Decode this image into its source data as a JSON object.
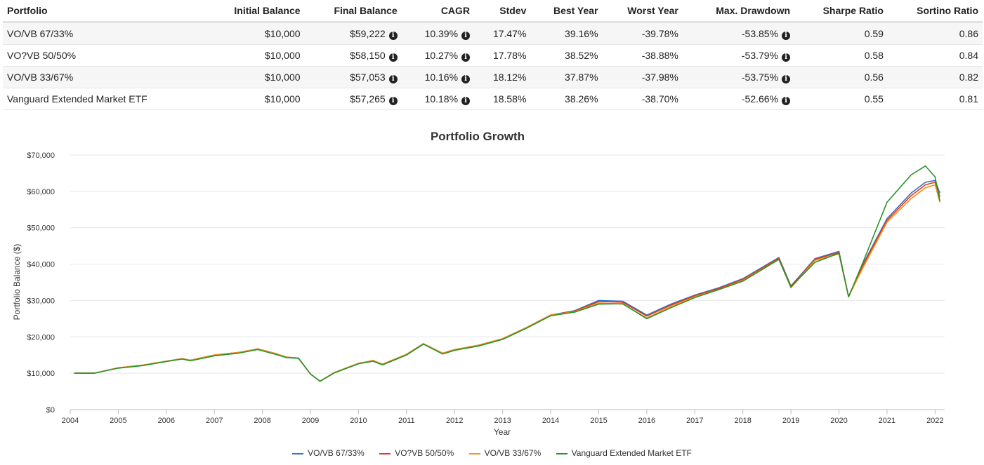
{
  "table": {
    "headers": [
      "Portfolio",
      "Initial Balance",
      "Final Balance",
      "CAGR",
      "Stdev",
      "Best Year",
      "Worst Year",
      "Max. Drawdown",
      "Sharpe Ratio",
      "Sortino Ratio"
    ],
    "rows": [
      {
        "portfolio": "VO/VB 67/33%",
        "initial": "$10,000",
        "final": "$59,222",
        "cagr": "10.39%",
        "stdev": "17.47%",
        "best": "39.16%",
        "worst": "-39.78%",
        "maxdd": "-53.85%",
        "sharpe": "0.59",
        "sortino": "0.86"
      },
      {
        "portfolio": "VO?VB 50/50%",
        "initial": "$10,000",
        "final": "$58,150",
        "cagr": "10.27%",
        "stdev": "17.78%",
        "best": "38.52%",
        "worst": "-38.88%",
        "maxdd": "-53.79%",
        "sharpe": "0.58",
        "sortino": "0.84"
      },
      {
        "portfolio": "VO/VB 33/67%",
        "initial": "$10,000",
        "final": "$57,053",
        "cagr": "10.16%",
        "stdev": "18.12%",
        "best": "37.87%",
        "worst": "-37.98%",
        "maxdd": "-53.75%",
        "sharpe": "0.56",
        "sortino": "0.82"
      },
      {
        "portfolio": "Vanguard Extended Market ETF",
        "initial": "$10,000",
        "final": "$57,265",
        "cagr": "10.18%",
        "stdev": "18.58%",
        "best": "38.26%",
        "worst": "-38.70%",
        "maxdd": "-52.66%",
        "sharpe": "0.55",
        "sortino": "0.81"
      }
    ]
  },
  "chart_data": {
    "type": "line",
    "title": "Portfolio Growth",
    "xlabel": "Year",
    "ylabel": "Portfolio Balance ($)",
    "xlim": [
      2004.0,
      2022.2
    ],
    "ylim": [
      0,
      70000
    ],
    "x_ticks": [
      "2004",
      "2005",
      "2006",
      "2007",
      "2008",
      "2009",
      "2010",
      "2011",
      "2012",
      "2013",
      "2014",
      "2015",
      "2016",
      "2017",
      "2018",
      "2019",
      "2020",
      "2021",
      "2022"
    ],
    "y_ticks": [
      "$0",
      "$10,000",
      "$20,000",
      "$30,000",
      "$40,000",
      "$50,000",
      "$60,000",
      "$70,000"
    ],
    "grid": true,
    "legend_position": "bottom",
    "x": [
      2004.08,
      2004.5,
      2005.0,
      2005.5,
      2006.0,
      2006.33,
      2006.5,
      2007.0,
      2007.5,
      2007.9,
      2008.25,
      2008.5,
      2008.75,
      2009.0,
      2009.2,
      2009.5,
      2010.0,
      2010.3,
      2010.5,
      2011.0,
      2011.35,
      2011.75,
      2012.0,
      2012.5,
      2013.0,
      2013.5,
      2014.0,
      2014.5,
      2015.0,
      2015.5,
      2016.0,
      2016.5,
      2017.0,
      2017.5,
      2018.0,
      2018.75,
      2019.0,
      2019.5,
      2020.0,
      2020.2,
      2020.5,
      2021.0,
      2021.5,
      2021.8,
      2022.0,
      2022.1
    ],
    "series": [
      {
        "name": "VO/VB 67/33%",
        "color": "#3a6fc4",
        "values": [
          10000,
          10000,
          11500,
          12200,
          13300,
          14000,
          13600,
          15000,
          15700,
          16700,
          15500,
          14400,
          14200,
          9800,
          7800,
          10200,
          12700,
          13500,
          12500,
          15200,
          18100,
          15500,
          16500,
          17700,
          19500,
          22600,
          26000,
          27200,
          30000,
          29800,
          26000,
          29000,
          31500,
          33500,
          36000,
          41800,
          34000,
          41500,
          43500,
          31000,
          40000,
          52500,
          59500,
          62500,
          63000,
          59500
        ]
      },
      {
        "name": "VO?VB 50/50%",
        "color": "#e03b1c",
        "values": [
          10000,
          10000,
          11500,
          12200,
          13300,
          14000,
          13600,
          15000,
          15700,
          16700,
          15500,
          14400,
          14200,
          9800,
          7800,
          10200,
          12700,
          13500,
          12500,
          15200,
          18100,
          15500,
          16500,
          17700,
          19500,
          22600,
          26000,
          27100,
          29700,
          29500,
          25700,
          28700,
          31300,
          33300,
          35800,
          41600,
          33800,
          41300,
          43200,
          31000,
          39600,
          52000,
          58800,
          61800,
          62500,
          58500
        ]
      },
      {
        "name": "VO/VB 33/67%",
        "color": "#f7941d",
        "values": [
          10000,
          10000,
          11500,
          12200,
          13300,
          14000,
          13600,
          15000,
          15700,
          16700,
          15500,
          14400,
          14200,
          9800,
          7800,
          10200,
          12700,
          13500,
          12500,
          15200,
          18100,
          15500,
          16500,
          17700,
          19500,
          22600,
          26000,
          26900,
          29300,
          29000,
          25200,
          28300,
          31000,
          33000,
          35500,
          41300,
          33500,
          41000,
          42800,
          31000,
          39000,
          51500,
          58000,
          61000,
          61800,
          57000
        ]
      },
      {
        "name": "Vanguard Extended Market ETF",
        "color": "#279327",
        "values": [
          10000,
          10000,
          11400,
          12100,
          13200,
          13900,
          13400,
          14800,
          15500,
          16500,
          15300,
          14300,
          14100,
          9800,
          7800,
          10100,
          12600,
          13300,
          12300,
          15000,
          18000,
          15300,
          16300,
          17500,
          19300,
          22400,
          25800,
          26800,
          29000,
          29100,
          25000,
          28000,
          30800,
          33000,
          35300,
          41300,
          33700,
          40500,
          43000,
          31000,
          40500,
          57000,
          64500,
          67000,
          64000,
          57300
        ]
      }
    ]
  }
}
